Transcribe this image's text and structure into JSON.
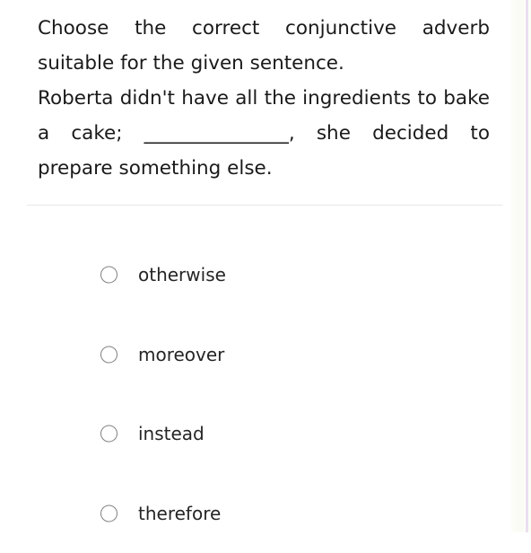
{
  "question": {
    "instruction": "Choose the correct conjunctive adverb suitable for the given sentence.",
    "sentence_part_1": "Roberta didn't have all the ingredients to bake a cake;",
    "blank": "_______________",
    "sentence_part_2": ", she decided to prepare something else.",
    "full_sentence": "Roberta didn't have all the ingredients to bake a cake; _______________, she decided to prepare something else."
  },
  "options": [
    {
      "label": "otherwise",
      "selected": false
    },
    {
      "label": "moreover",
      "selected": false
    },
    {
      "label": "instead",
      "selected": false
    },
    {
      "label": "therefore",
      "selected": false
    }
  ],
  "colors": {
    "page_background": "#ffffff",
    "text": "#1a1a1a",
    "option_text": "#252525",
    "divider": "#e8e8e8",
    "radio_border": "#808080",
    "scrollbar_thumb": "#b6b6b0",
    "gutter_background": "#fdfdf7",
    "edge_accent": "#ecdff0"
  }
}
